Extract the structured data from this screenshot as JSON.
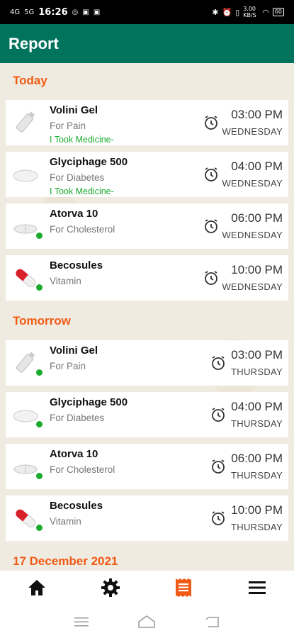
{
  "status_bar": {
    "time": "16:26",
    "left_icons": [
      "4G",
      "5G",
      "whatsapp-icon",
      "facebook-icon",
      "facebook-icon"
    ],
    "right_icons": [
      "bluetooth-icon",
      "alarm-icon",
      "vibrate-icon",
      "wifi-icon"
    ],
    "data_speed": "3.00 KB/S",
    "battery": "60"
  },
  "app_bar": {
    "title": "Report"
  },
  "sections": [
    {
      "title": "Today",
      "items": [
        {
          "name": "Volini Gel",
          "purpose": "For Pain",
          "status": "I Took Medicine-",
          "time": "03:00 PM",
          "day": "WEDNESDAY",
          "icon": "gel-tube-icon",
          "dot": false
        },
        {
          "name": "Glyciphage 500",
          "purpose": "For Diabetes",
          "status": "I Took Medicine-",
          "time": "04:00 PM",
          "day": "WEDNESDAY",
          "icon": "tablet-icon",
          "dot": false
        },
        {
          "name": "Atorva 10",
          "purpose": "For Cholesterol",
          "status": "",
          "time": "06:00 PM",
          "day": "WEDNESDAY",
          "icon": "scored-tablet-icon",
          "dot": true
        },
        {
          "name": "Becosules",
          "purpose": "Vitamin",
          "status": "",
          "time": "10:00 PM",
          "day": "WEDNESDAY",
          "icon": "capsule-icon",
          "dot": true
        }
      ]
    },
    {
      "title": "Tomorrow",
      "items": [
        {
          "name": "Volini Gel",
          "purpose": "For Pain",
          "status": "",
          "time": "03:00 PM",
          "day": "THURSDAY",
          "icon": "gel-tube-icon",
          "dot": true
        },
        {
          "name": "Glyciphage 500",
          "purpose": "For Diabetes",
          "status": "",
          "time": "04:00 PM",
          "day": "THURSDAY",
          "icon": "tablet-icon",
          "dot": true
        },
        {
          "name": "Atorva 10",
          "purpose": "For Cholesterol",
          "status": "",
          "time": "06:00 PM",
          "day": "THURSDAY",
          "icon": "scored-tablet-icon",
          "dot": true
        },
        {
          "name": "Becosules",
          "purpose": "Vitamin",
          "status": "",
          "time": "10:00 PM",
          "day": "THURSDAY",
          "icon": "capsule-icon",
          "dot": true
        }
      ]
    },
    {
      "title": "17 December 2021",
      "items": []
    }
  ],
  "bottom_nav": [
    {
      "icon": "home-icon",
      "active": false
    },
    {
      "icon": "settings-icon",
      "active": false
    },
    {
      "icon": "report-icon",
      "active": true
    },
    {
      "icon": "menu-icon",
      "active": false
    }
  ],
  "colors": {
    "primary": "#00735c",
    "accent": "#f05a14",
    "taken": "#1aab2c",
    "background": "#f0ebe0"
  }
}
